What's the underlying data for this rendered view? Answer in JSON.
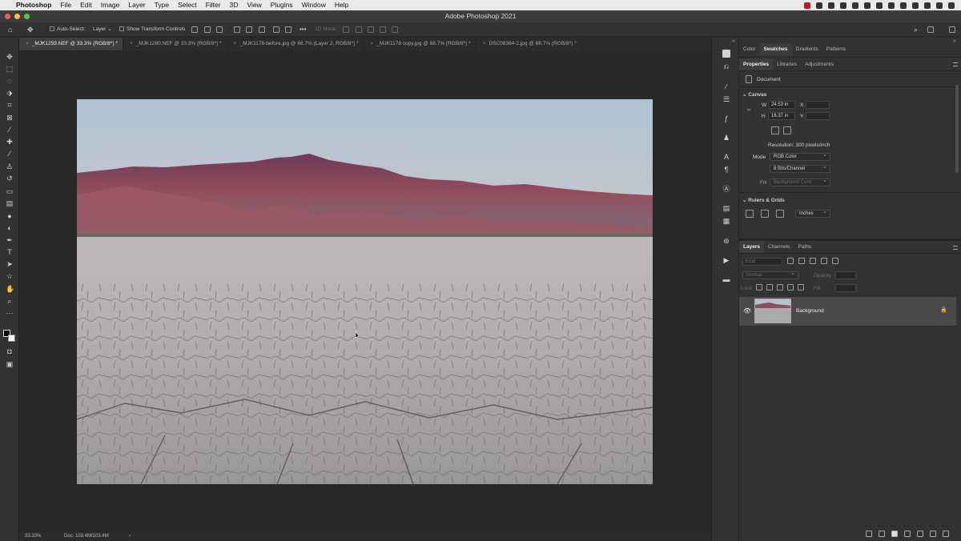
{
  "menubar": {
    "app_name": "Photoshop",
    "items": [
      "File",
      "Edit",
      "Image",
      "Layer",
      "Type",
      "Select",
      "Filter",
      "3D",
      "View",
      "Plugins",
      "Window",
      "Help"
    ]
  },
  "window": {
    "title": "Adobe Photoshop 2021"
  },
  "options_bar": {
    "auto_select_label": "Auto-Select:",
    "auto_select_value": "Layer",
    "show_transform_label": "Show Transform Controls",
    "more_label": "•••",
    "mode_3d_label": "3D Mode:"
  },
  "tabs": [
    {
      "label": "_MJK1259.NEF @ 33.3% (RGB/8*) *"
    },
    {
      "label": "_MJK1280.NEF @ 33.3% (RGB/8*) *"
    },
    {
      "label": "_MJK1178-before.jpg @ 66.7% (Layer 2, RGB/8*) *"
    },
    {
      "label": "_MJK1178 copy.jpg @ 66.7% (RGB/8*) *"
    },
    {
      "label": "DSC08384-2.jpg @ 66.7% (RGB/8*) *"
    }
  ],
  "status_bar": {
    "zoom": "33.33%",
    "doc": "Doc: 103.4M/103.4M",
    "arrow": "›"
  },
  "color_panel": {
    "tabs": [
      "Color",
      "Swatches",
      "Gradients",
      "Patterns"
    ],
    "active": "Swatches"
  },
  "properties_panel": {
    "tabs": [
      "Properties",
      "Libraries",
      "Adjustments"
    ],
    "document_label": "Document",
    "canvas_section": "Canvas",
    "width_label": "W",
    "width_value": "24.53 in",
    "height_label": "H",
    "height_value": "16.37 in",
    "x_label": "X",
    "y_label": "Y",
    "resolution": "Resolution: 300 pixels/inch",
    "mode_label": "Mode",
    "mode_value": "RGB Color",
    "bits_value": "8 Bits/Channel",
    "fill_label": "Fill",
    "fill_value": "Background Color",
    "rulers_section": "Rulers & Grids",
    "units_value": "Inches"
  },
  "layers_panel": {
    "tabs": [
      "Layers",
      "Channels",
      "Paths"
    ],
    "filter_placeholder": "Kind",
    "blend_mode": "Normal",
    "opacity_label": "Opacity:",
    "lock_label": "Lock:",
    "fill_label": "Fill:",
    "layers": [
      {
        "name": "Background",
        "visible": true,
        "locked": true
      }
    ]
  },
  "colors": {
    "sky_top": "#b3c6d3",
    "sky_bottom": "#c4c6cc",
    "mountain": "#8a4a5e",
    "playa": "#a7a5a6"
  }
}
